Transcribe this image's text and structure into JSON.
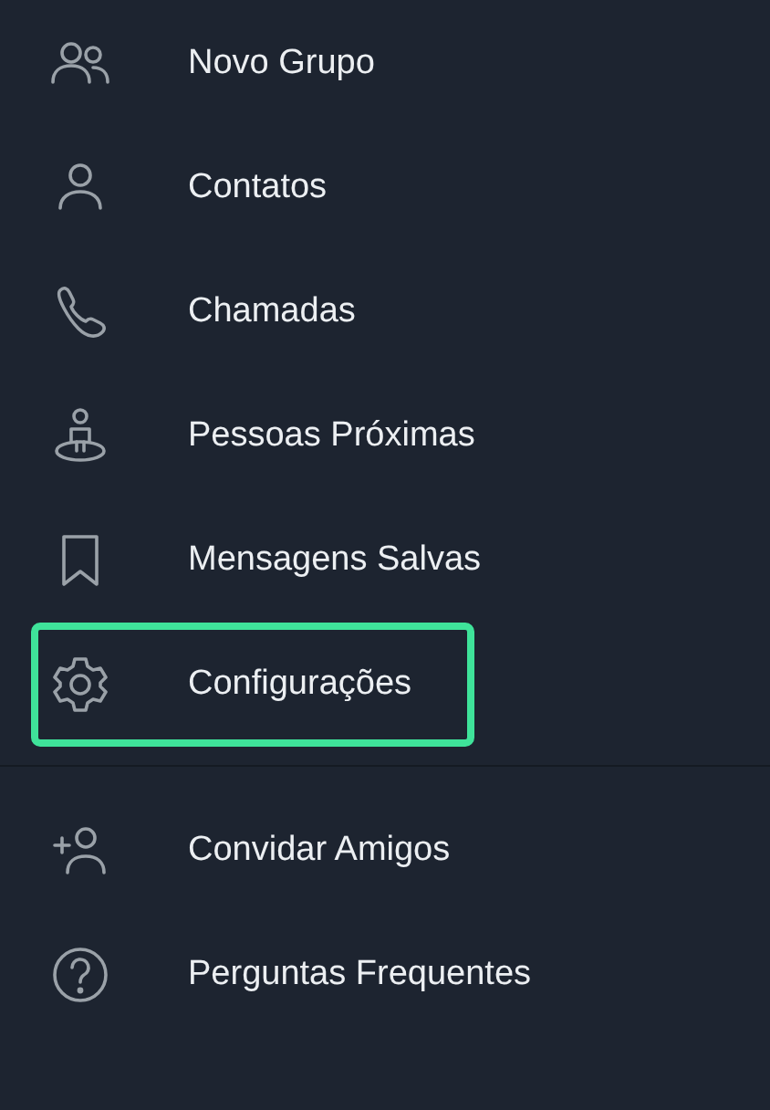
{
  "menu_items": [
    {
      "kind": "group",
      "label": "Novo Grupo",
      "selected": false
    },
    {
      "kind": "person",
      "label": "Contatos",
      "selected": false
    },
    {
      "kind": "phone",
      "label": "Chamadas",
      "selected": false
    },
    {
      "kind": "nearby",
      "label": "Pessoas Próximas",
      "selected": false
    },
    {
      "kind": "bookmark",
      "label": "Mensagens Salvas",
      "selected": false
    },
    {
      "kind": "gear",
      "label": "Configurações",
      "selected": true
    }
  ],
  "extra_items": [
    {
      "kind": "add-person",
      "label": "Convidar Amigos",
      "selected": false
    },
    {
      "kind": "question",
      "label": "Perguntas Frequentes",
      "selected": false
    }
  ]
}
